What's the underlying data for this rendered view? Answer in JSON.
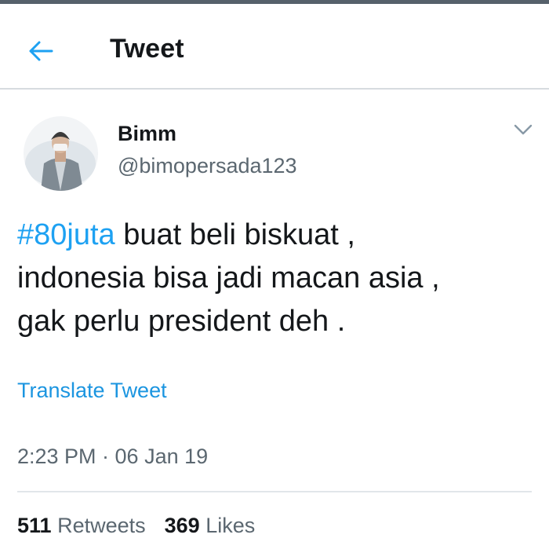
{
  "header": {
    "title": "Tweet",
    "back_icon": "arrow-left-icon",
    "accent_color": "#1da1f2"
  },
  "tweet": {
    "author": {
      "name": "Bimm",
      "handle": "@bimopersada123"
    },
    "menu_icon": "chevron-down-icon",
    "hashtag": "#80juta",
    "text_line1": " buat beli biskuat ,",
    "text_line2": "indonesia bisa jadi macan asia ,",
    "text_line3": "gak perlu president deh .",
    "translate_label": "Translate Tweet",
    "timestamp": "2:23 PM · 06 Jan 19",
    "stats": {
      "retweets_count": "511",
      "retweets_label": "Retweets",
      "likes_count": "369",
      "likes_label": "Likes"
    }
  }
}
